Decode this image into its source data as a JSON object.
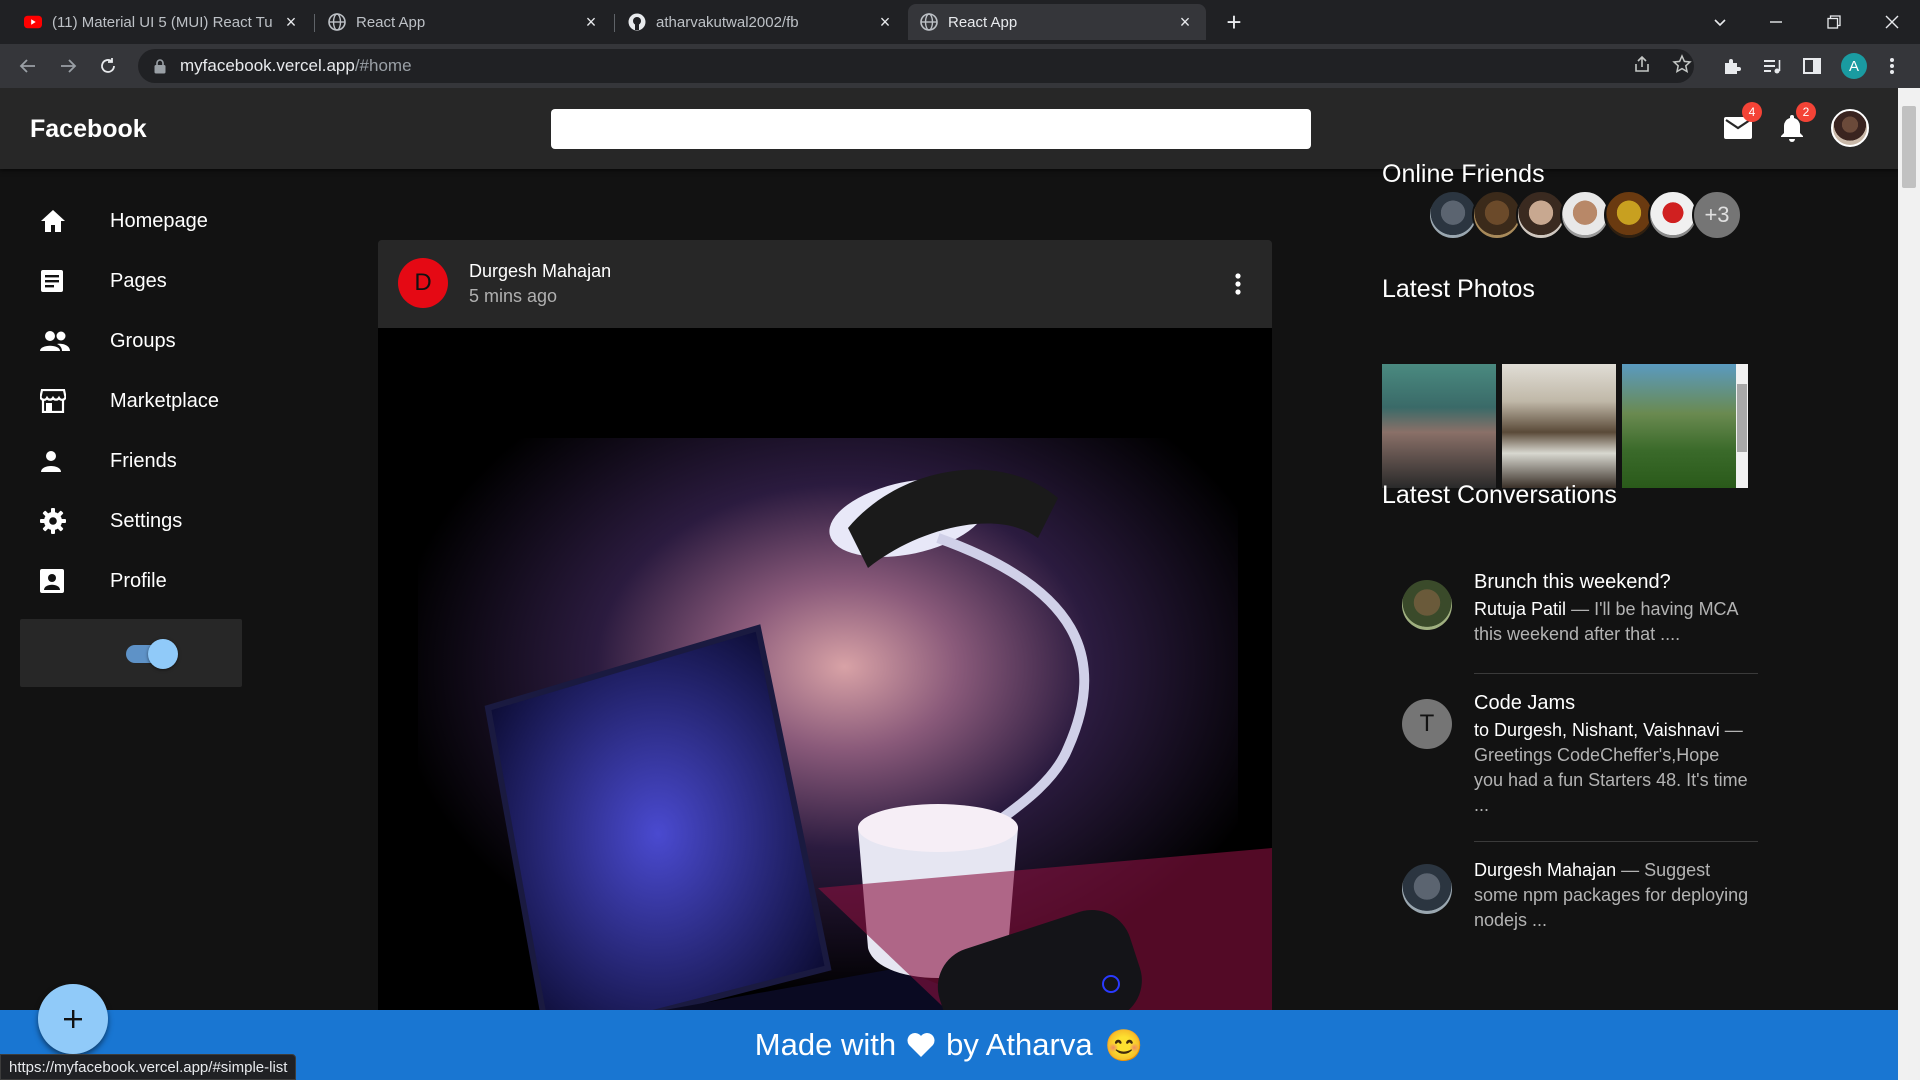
{
  "browser": {
    "tabs": [
      {
        "title": "(11) Material UI 5 (MUI) React Tu",
        "icon": "youtube-icon",
        "active": false
      },
      {
        "title": "React App",
        "icon": "globe-icon",
        "active": false
      },
      {
        "title": "atharvakutwal2002/fb",
        "icon": "github-icon",
        "active": false
      },
      {
        "title": "React App",
        "icon": "globe-icon",
        "active": true
      }
    ],
    "url_host": "myfacebook.vercel.app",
    "url_path": "/#home",
    "profile_initial": "A",
    "status_url": "https://myfacebook.vercel.app/#simple-list"
  },
  "appbar": {
    "brand": "Facebook",
    "search_placeholder": "",
    "mail_badge": "4",
    "notifications_badge": "2"
  },
  "sidebar": {
    "items": [
      {
        "label": "Homepage",
        "icon": "home-icon"
      },
      {
        "label": "Pages",
        "icon": "article-icon"
      },
      {
        "label": "Groups",
        "icon": "group-icon"
      },
      {
        "label": "Marketplace",
        "icon": "storefront-icon"
      },
      {
        "label": "Friends",
        "icon": "person-icon"
      },
      {
        "label": "Settings",
        "icon": "gear-icon"
      },
      {
        "label": "Profile",
        "icon": "account-box-icon"
      }
    ],
    "dark_mode_on": true
  },
  "post": {
    "avatar_letter": "D",
    "author": "Durgesh Mahajan",
    "time": "5 mins ago"
  },
  "rightbar": {
    "online_title": "Online Friends",
    "online_more": "+3",
    "photos_title": "Latest Photos",
    "conversations_title": "Latest Conversations",
    "conversations": [
      {
        "primary": "Brunch this weekend?",
        "sender": "Rutuja Patil",
        "text": " — I'll be having MCA this weekend after that ...."
      },
      {
        "primary": "Code Jams",
        "avatar_letter": "T",
        "sender": "to Durgesh, Nishant, Vaishnavi",
        "text": " — Greetings CodeCheffer's,Hope you had a fun Starters 48. It's time ..."
      },
      {
        "primary": "",
        "sender": "Durgesh Mahajan",
        "text": " — Suggest some npm packages for deploying nodejs ..."
      }
    ]
  },
  "footer": {
    "before": "Made with",
    "after": "by Atharva",
    "emoji": "😊"
  },
  "colors": {
    "accent": "#1976d2",
    "fab": "#90caf9",
    "badge": "#f44336",
    "surface": "#272727",
    "background": "#121212"
  }
}
